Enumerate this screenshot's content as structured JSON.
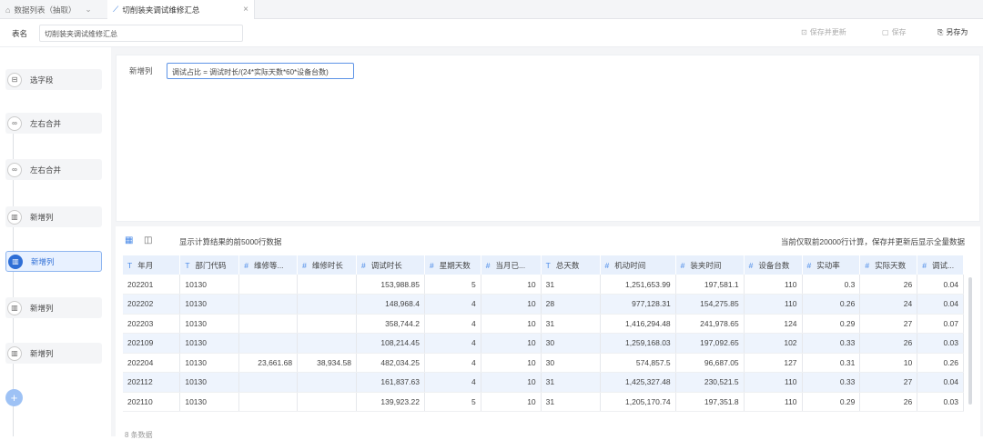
{
  "tabs": [
    {
      "label": "数据列表（抽取）",
      "icon": "home-icon"
    },
    {
      "label": "切削装夹调试维修汇总",
      "icon": "line-chart-icon"
    }
  ],
  "table_name": {
    "label": "表名",
    "value": "切削装夹调试维修汇总"
  },
  "actions": {
    "save_update": "保存并更新",
    "save": "保存",
    "save_as": "另存为"
  },
  "steps": [
    {
      "label": "选字段",
      "icon": "select-field-icon",
      "active": false
    },
    {
      "label": "左右合并",
      "icon": "merge-icon",
      "active": false
    },
    {
      "label": "左右合并",
      "icon": "merge-icon",
      "active": false
    },
    {
      "label": "新增列",
      "icon": "add-column-icon",
      "active": false
    },
    {
      "label": "新增列",
      "icon": "add-column-icon",
      "active": true
    },
    {
      "label": "新增列",
      "icon": "add-column-icon",
      "active": false
    },
    {
      "label": "新增列",
      "icon": "add-column-icon",
      "active": false
    }
  ],
  "editor": {
    "label": "新增列",
    "formula": "调试占比 = 调试时长/(24*实际天数*60*设备台数)"
  },
  "result": {
    "info": "显示计算结果的前5000行数据",
    "note": "当前仅取前20000行计算，保存并更新后显示全量数据"
  },
  "columns": [
    {
      "type": "T",
      "name": "年月"
    },
    {
      "type": "T",
      "name": "部门代码"
    },
    {
      "type": "#",
      "name": "维修等..."
    },
    {
      "type": "#",
      "name": "维修时长"
    },
    {
      "type": "#",
      "name": "调试时长"
    },
    {
      "type": "#",
      "name": "星期天数"
    },
    {
      "type": "#",
      "name": "当月已..."
    },
    {
      "type": "T",
      "name": "总天数"
    },
    {
      "type": "#",
      "name": "机动时间"
    },
    {
      "type": "#",
      "name": "装夹时间"
    },
    {
      "type": "#",
      "name": "设备台数"
    },
    {
      "type": "#",
      "name": "实动率"
    },
    {
      "type": "#",
      "name": "实际天数"
    },
    {
      "type": "#",
      "name": "调试..."
    }
  ],
  "rows": [
    [
      "202201",
      "10130",
      "",
      "",
      "153,988.85",
      "5",
      "10",
      "31",
      "1,251,653.99",
      "197,581.1",
      "110",
      "0.3",
      "26",
      "0.04"
    ],
    [
      "202202",
      "10130",
      "",
      "",
      "148,968.4",
      "4",
      "10",
      "28",
      "977,128.31",
      "154,275.85",
      "110",
      "0.26",
      "24",
      "0.04"
    ],
    [
      "202203",
      "10130",
      "",
      "",
      "358,744.2",
      "4",
      "10",
      "31",
      "1,416,294.48",
      "241,978.65",
      "124",
      "0.29",
      "27",
      "0.07"
    ],
    [
      "202109",
      "10130",
      "",
      "",
      "108,214.45",
      "4",
      "10",
      "30",
      "1,259,168.03",
      "197,092.65",
      "102",
      "0.33",
      "26",
      "0.03"
    ],
    [
      "202204",
      "10130",
      "23,661.68",
      "38,934.58",
      "482,034.25",
      "4",
      "10",
      "30",
      "574,857.5",
      "96,687.05",
      "127",
      "0.31",
      "10",
      "0.26"
    ],
    [
      "202112",
      "10130",
      "",
      "",
      "161,837.63",
      "4",
      "10",
      "31",
      "1,425,327.48",
      "230,521.5",
      "110",
      "0.33",
      "27",
      "0.04"
    ],
    [
      "202110",
      "10130",
      "",
      "",
      "139,923.22",
      "5",
      "10",
      "31",
      "1,205,170.74",
      "197,351.8",
      "110",
      "0.29",
      "26",
      "0.03"
    ]
  ],
  "footer": "8 条数据"
}
